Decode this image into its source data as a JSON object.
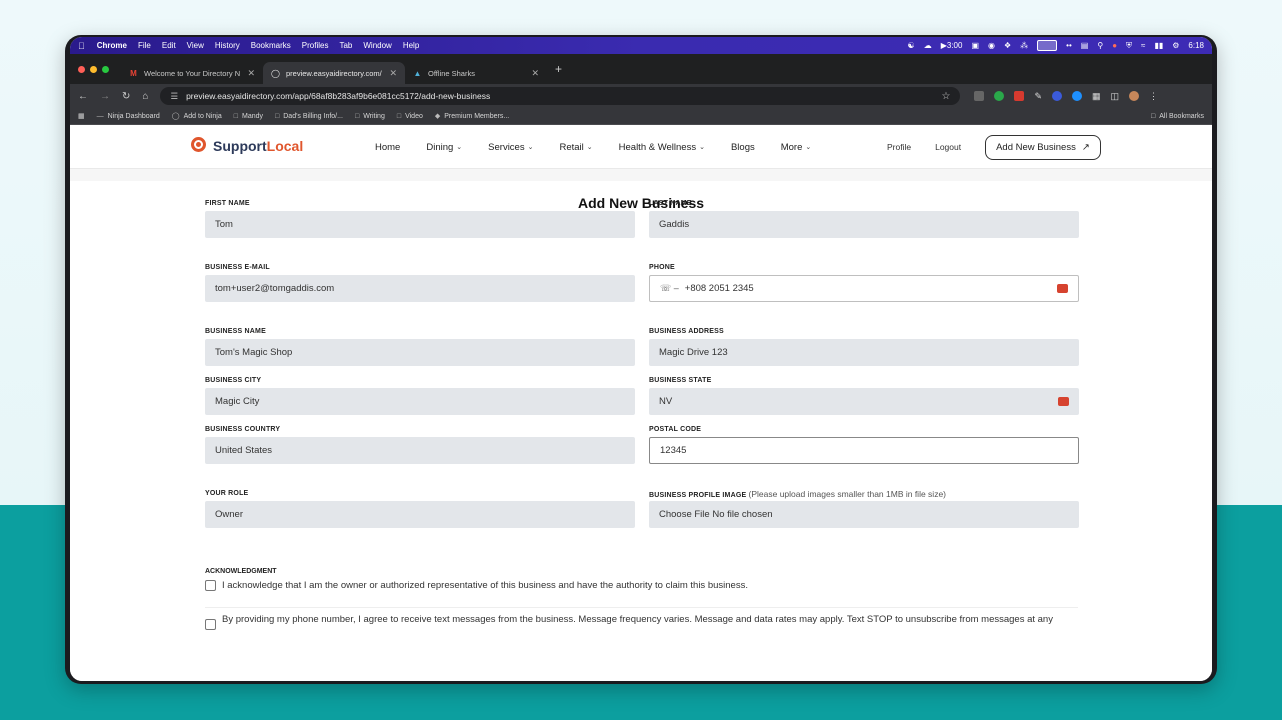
{
  "menubar": {
    "app": "Chrome",
    "items": [
      "File",
      "Edit",
      "View",
      "History",
      "Bookmarks",
      "Profiles",
      "Tab",
      "Window",
      "Help"
    ],
    "timer": "3:00",
    "clock": "6:18"
  },
  "tabs": [
    {
      "title": "Welcome to Your Directory N",
      "active": false
    },
    {
      "title": "preview.easyaidirectory.com/",
      "active": true
    },
    {
      "title": "Offline Sharks",
      "active": false
    }
  ],
  "address": {
    "url": "preview.easyaidirectory.com/app/68af8b283af9b6e081cc5172/add-new-business"
  },
  "bookmarks": {
    "items": [
      "Ninja Dashboard",
      "Add to Ninja",
      "Mandy",
      "Dad's Billing Info/...",
      "Writing",
      "Video",
      "Premium Members..."
    ],
    "all": "All Bookmarks"
  },
  "site": {
    "logo_main": "Support",
    "logo_accent": "Local",
    "nav": {
      "home": "Home",
      "dining": "Dining",
      "services": "Services",
      "retail": "Retail",
      "health": "Health & Wellness",
      "blogs": "Blogs",
      "more": "More"
    },
    "profile": "Profile",
    "logout": "Logout",
    "add_business": "Add New Business"
  },
  "form": {
    "title": "Add New Business",
    "first_name": {
      "label": "FIRST NAME",
      "value": "Tom"
    },
    "last_name": {
      "label": "LAST NAME",
      "value": "Gaddis"
    },
    "email": {
      "label": "BUSINESS E-MAIL",
      "value": "tom+user2@tomgaddis.com"
    },
    "phone": {
      "label": "PHONE",
      "value": "+808 2051 2345"
    },
    "business_name": {
      "label": "BUSINESS NAME",
      "value": "Tom's Magic Shop"
    },
    "business_address": {
      "label": "BUSINESS ADDRESS",
      "value": "Magic Drive 123"
    },
    "business_city": {
      "label": "BUSINESS CITY",
      "value": "Magic City"
    },
    "business_state": {
      "label": "BUSINESS STATE",
      "value": "NV"
    },
    "business_country": {
      "label": "BUSINESS COUNTRY",
      "value": "United States"
    },
    "postal_code": {
      "label": "POSTAL CODE",
      "value": "12345"
    },
    "role": {
      "label": "YOUR ROLE",
      "value": "Owner"
    },
    "profile_image": {
      "label": "BUSINESS PROFILE IMAGE",
      "note": "(Please upload images smaller than 1MB in file size)",
      "value": "Choose File No file chosen"
    },
    "ack_title": "ACKNOWLEDGMENT",
    "ack_owner": "I acknowledge that I am the owner or authorized representative of this business and have the authority to claim this business.",
    "ack_sms": "By providing my phone number, I agree to receive text messages from the business. Message frequency varies. Message and data rates may apply. Text STOP to unsubscribe from messages at any"
  }
}
